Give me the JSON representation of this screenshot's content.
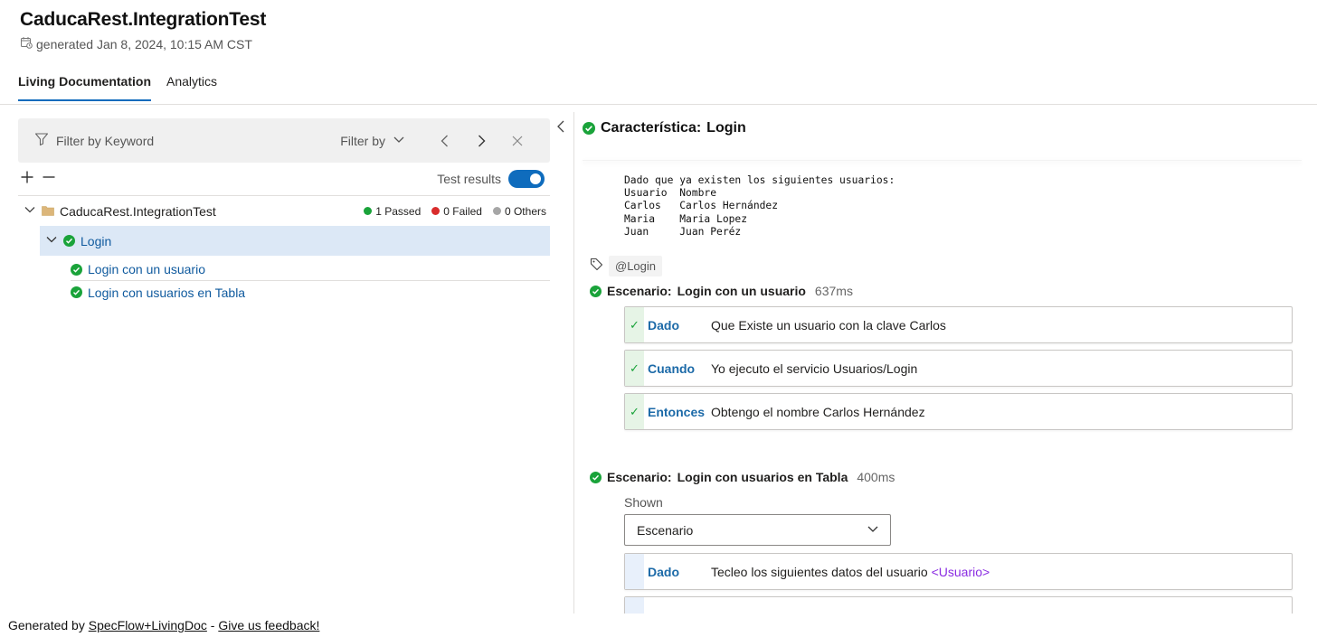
{
  "header": {
    "title": "CaducaRest.IntegrationTest",
    "generated": "generated Jan 8, 2024, 10:15 AM CST"
  },
  "tabs": [
    {
      "label": "Living Documentation",
      "active": true
    },
    {
      "label": "Analytics",
      "active": false
    }
  ],
  "filter": {
    "placeholder": "Filter by Keyword",
    "filter_by_label": "Filter by"
  },
  "tools": {
    "test_results_label": "Test results",
    "test_results_on": true
  },
  "tree": {
    "root": {
      "name": "CaducaRest.IntegrationTest",
      "passed": "1 Passed",
      "failed": "0 Failed",
      "others": "0 Others"
    },
    "feature": "Login",
    "scenarios": [
      "Login con un usuario",
      "Login con usuarios en Tabla"
    ]
  },
  "colors": {
    "accent": "#0f6cbd",
    "passed": "#1aa33a",
    "failed": "#d92c2c",
    "others": "#a6a6a6",
    "selected_row": "#dce8f6",
    "param": "#8a2be2"
  },
  "detail": {
    "feature_prefix": "Característica:",
    "feature_name": "Login",
    "description": "Dado que ya existen los siguientes usuarios:\nUsuario  Nombre\nCarlos   Carlos Hernández\nMaria    Maria Lopez\nJuan     Juan Peréz",
    "tag": "@Login",
    "scenario_prefix": "Escenario:",
    "scenario1": {
      "name": "Login con un usuario",
      "duration": "637ms",
      "steps": [
        {
          "keyword": "Dado",
          "text": "Que Existe un usuario con la clave Carlos"
        },
        {
          "keyword": "Cuando",
          "text": "Yo ejecuto el servicio Usuarios/Login"
        },
        {
          "keyword": "Entonces",
          "text": "Obtengo el nombre Carlos Hernández"
        }
      ]
    },
    "scenario2": {
      "name": "Login con usuarios en Tabla",
      "duration": "400ms",
      "shown_label": "Shown",
      "shown_value": "Escenario",
      "steps": [
        {
          "keyword": "Dado",
          "text": "Tecleo los siguientes datos del usuario ",
          "param": "<Usuario>"
        }
      ]
    }
  },
  "footer": {
    "prefix": "Generated by ",
    "link1": "SpecFlow+LivingDoc",
    "separator": " - ",
    "link2": "Give us feedback!"
  }
}
